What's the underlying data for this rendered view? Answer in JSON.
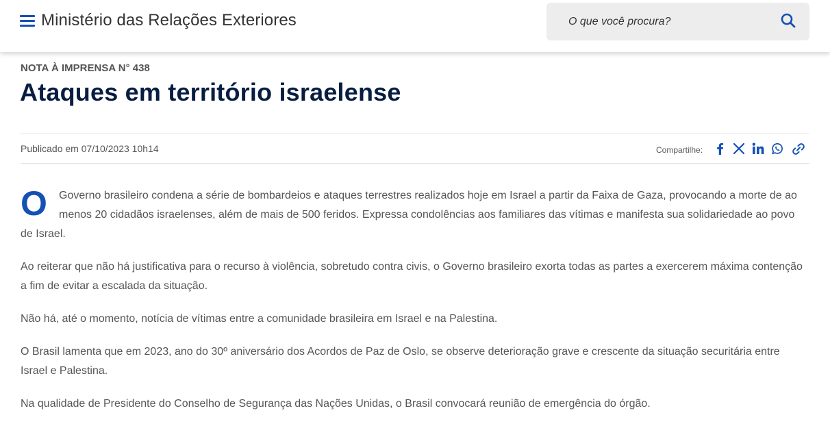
{
  "header": {
    "site_title": "Ministério das Relações Exteriores",
    "search_placeholder": "O que você procura?"
  },
  "article": {
    "kicker": "NOTA À IMPRENSA N° 438",
    "title": "Ataques em território israelense",
    "published": "Publicado em 07/10/2023 10h14",
    "share_label": "Compartilhe:",
    "share_icons": [
      "facebook-icon",
      "x-icon",
      "linkedin-icon",
      "whatsapp-icon",
      "link-icon"
    ],
    "dropcap": "O",
    "first_paragraph": "Governo brasileiro condena a série de bombardeios e ataques terrestres realizados hoje em Israel a partir da Faixa de Gaza, provocando a morte de ao menos 20 cidadãos israelenses, além de mais de 500 feridos. Expressa condolências aos familiares das vítimas e manifesta sua solidariedade ao povo de Israel.",
    "paragraphs": [
      "Ao reiterar que não há justificativa para o recurso à violência, sobretudo contra civis, o Governo brasileiro exorta todas as partes a exercerem máxima contenção a fim de evitar a escalada da situação.",
      "Não há, até o momento, notícia de vítimas entre a comunidade brasileira em Israel e na Palestina.",
      "O Brasil lamenta que em 2023, ano do 30º aniversário dos Acordos de Paz de Oslo, se observe deterioração grave e crescente da situação securitária entre Israel e Palestina.",
      "Na qualidade de Presidente do Conselho de Segurança das Nações Unidas, o Brasil convocará reunião de emergência do órgão."
    ]
  },
  "colors": {
    "brand_blue": "#1351b4",
    "title_navy": "#071d41",
    "text_gray": "#555555",
    "search_bg": "#ededed"
  }
}
